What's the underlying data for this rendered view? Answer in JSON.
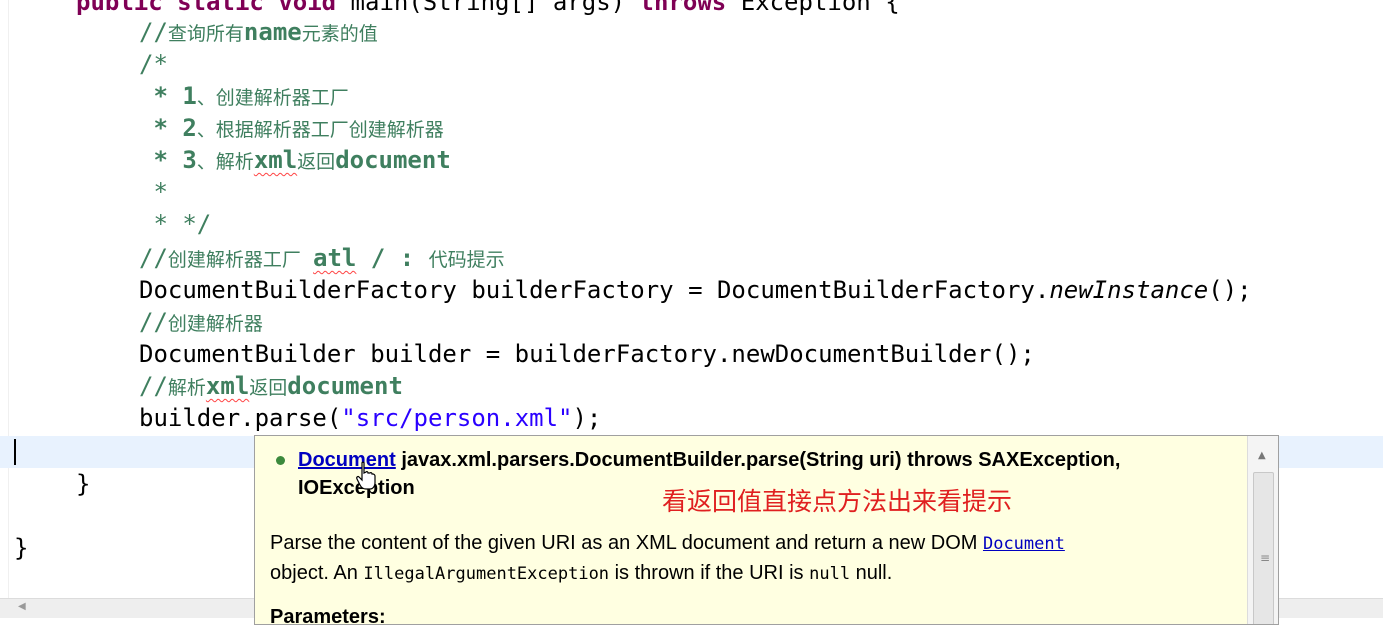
{
  "editor": {
    "line1": {
      "kw1": "public",
      "kw2": "static",
      "kw3": "void",
      "rest1": " main(String[] args) ",
      "kw4": "throws",
      "rest2": " Exception {"
    },
    "line2": {
      "a": "//",
      "b": "查询所有",
      "c": "name",
      "d": "元素的值"
    },
    "line3": {
      "a": "/*"
    },
    "line4": {
      "a": " * 1",
      "b": "、创建解析器工厂"
    },
    "line5": {
      "a": " * 2",
      "b": "、根据解析器工厂创建解析器"
    },
    "line6": {
      "a": " * 3",
      "b": "、解析",
      "c": "xml",
      "d": "返回",
      "e": "document"
    },
    "line7": {
      "a": " *"
    },
    "line8": {
      "a": " * */"
    },
    "line9": {
      "a": "//",
      "b": "创建解析器工厂  ",
      "c": "atl",
      "d": " / : ",
      "e": "代码提示"
    },
    "line10": {
      "a": "DocumentBuilderFactory builderFactory = DocumentBuilderFactory.",
      "b": "newInstance",
      "c": "();"
    },
    "line11": {
      "a": "//",
      "b": "创建解析器"
    },
    "line12": {
      "a": "DocumentBuilder builder = builderFactory.newDocumentBuilder();"
    },
    "line13": {
      "a": "//",
      "b": "解析",
      "c": "xml",
      "d": "返回",
      "e": "document"
    },
    "line14": {
      "a": "builder.parse(",
      "b": "\"src/person.xml\"",
      "c": ");"
    },
    "line16": {
      "a": "}"
    },
    "line18": {
      "a": "}"
    }
  },
  "javadoc": {
    "sig_link": "Document",
    "sig_rest": " javax.xml.parsers.DocumentBuilder.parse(String uri) throws SAXException,",
    "sig_line2": "IOException",
    "desc_1": "Parse the content of the given URI as an XML document and return a new DOM ",
    "desc_link": "Document",
    "desc_2": "object. An ",
    "desc_code1": "IllegalArgumentException",
    "desc_3": " is thrown if the URI is ",
    "desc_code2": "null",
    "desc_4": " null.",
    "params": "Parameters:",
    "scroll_grip": "≡",
    "scroll_up": "▲"
  },
  "annotation": "看返回值直接点方法出来看提示",
  "hscroll_arrow": "◀",
  "icons": {
    "bullet": "method-bullet-icon",
    "cursor": "hand-cursor-icon"
  }
}
